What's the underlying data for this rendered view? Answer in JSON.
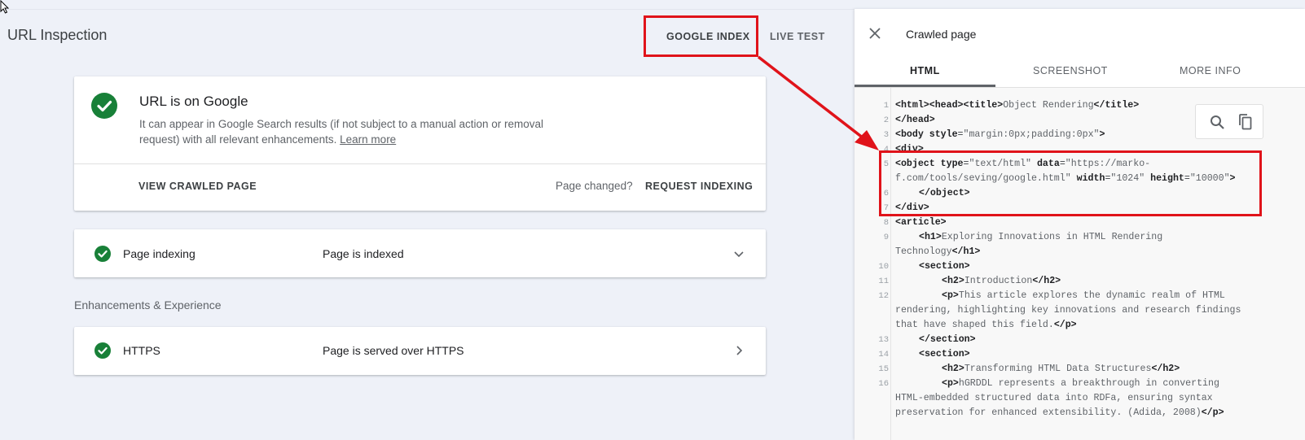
{
  "page": {
    "title": "URL Inspection"
  },
  "top_tabs": {
    "google_index": "GOOGLE INDEX",
    "live_test": "LIVE TEST"
  },
  "status_card": {
    "title": "URL is on Google",
    "description": "It can appear in Google Search results (if not subject to a manual action or removal request) with all relevant enhancements.",
    "learn_more": "Learn more",
    "view_crawled": "VIEW CRAWLED PAGE",
    "page_changed": "Page changed?",
    "request_indexing": "REQUEST INDEXING"
  },
  "indexing_row": {
    "label": "Page indexing",
    "value": "Page is indexed"
  },
  "enhancements": {
    "section_label": "Enhancements & Experience",
    "https_label": "HTTPS",
    "https_value": "Page is served over HTTPS"
  },
  "panel": {
    "title": "Crawled page",
    "tabs": [
      "HTML",
      "SCREENSHOT",
      "MORE INFO"
    ],
    "active_tab": "HTML"
  },
  "colors": {
    "success": "#188038",
    "annotation": "#e0131a",
    "panel_bg": "#f8f8f8"
  },
  "icons": [
    "check-circle-icon",
    "chevron-down-icon",
    "chevron-right-icon",
    "close-icon",
    "search-icon",
    "copy-icon",
    "arrow-annotation"
  ],
  "code": {
    "line_numbers": [
      "1",
      "2",
      "3",
      "4",
      "5",
      "6",
      "7",
      "8",
      "9",
      "10",
      "11",
      "12",
      "13",
      "14",
      "15",
      "16"
    ],
    "l1": [
      "<html>",
      "<head>",
      "<title>",
      "Object Rendering",
      "</title>"
    ],
    "l2": [
      "</head>"
    ],
    "l3": [
      "<body ",
      "style",
      "=",
      "\"margin:0px;padding:0px\"",
      ">"
    ],
    "l4": [
      "<div>"
    ],
    "l5": [
      "<object ",
      "type",
      "=",
      "\"text/html\"",
      " data",
      "=",
      "\"https://marko-"
    ],
    "l5b": [
      "f.com/tools/seving/google.html\"",
      " width",
      "=",
      "\"1024\"",
      " height",
      "=",
      "\"10000\"",
      ">"
    ],
    "l6": [
      "</object>"
    ],
    "l7": [
      "</div>"
    ],
    "l8": [
      "<article>"
    ],
    "l9": [
      "<h1>",
      "Exploring Innovations in HTML Rendering"
    ],
    "l9b": [
      "Technology",
      "</h1>"
    ],
    "l10": [
      "<section>"
    ],
    "l11": [
      "<h2>",
      "Introduction",
      "</h2>"
    ],
    "l12": [
      "<p>",
      "This article explores the dynamic realm of HTML"
    ],
    "l12b": "rendering, highlighting key innovations and research findings",
    "l12c": [
      "that have shaped this field.",
      "</p>"
    ],
    "l13": [
      "</section>"
    ],
    "l14": [
      "<section>"
    ],
    "l15": [
      "<h2>",
      "Transforming HTML Data Structures",
      "</h2>"
    ],
    "l16": [
      "<p>",
      "hGRDDL represents a breakthrough in converting"
    ],
    "l16b": "HTML-embedded structured data into RDFa, ensuring syntax",
    "l16c": [
      "preservation for enhanced extensibility. (Adida, 2008)",
      "</p>"
    ]
  }
}
